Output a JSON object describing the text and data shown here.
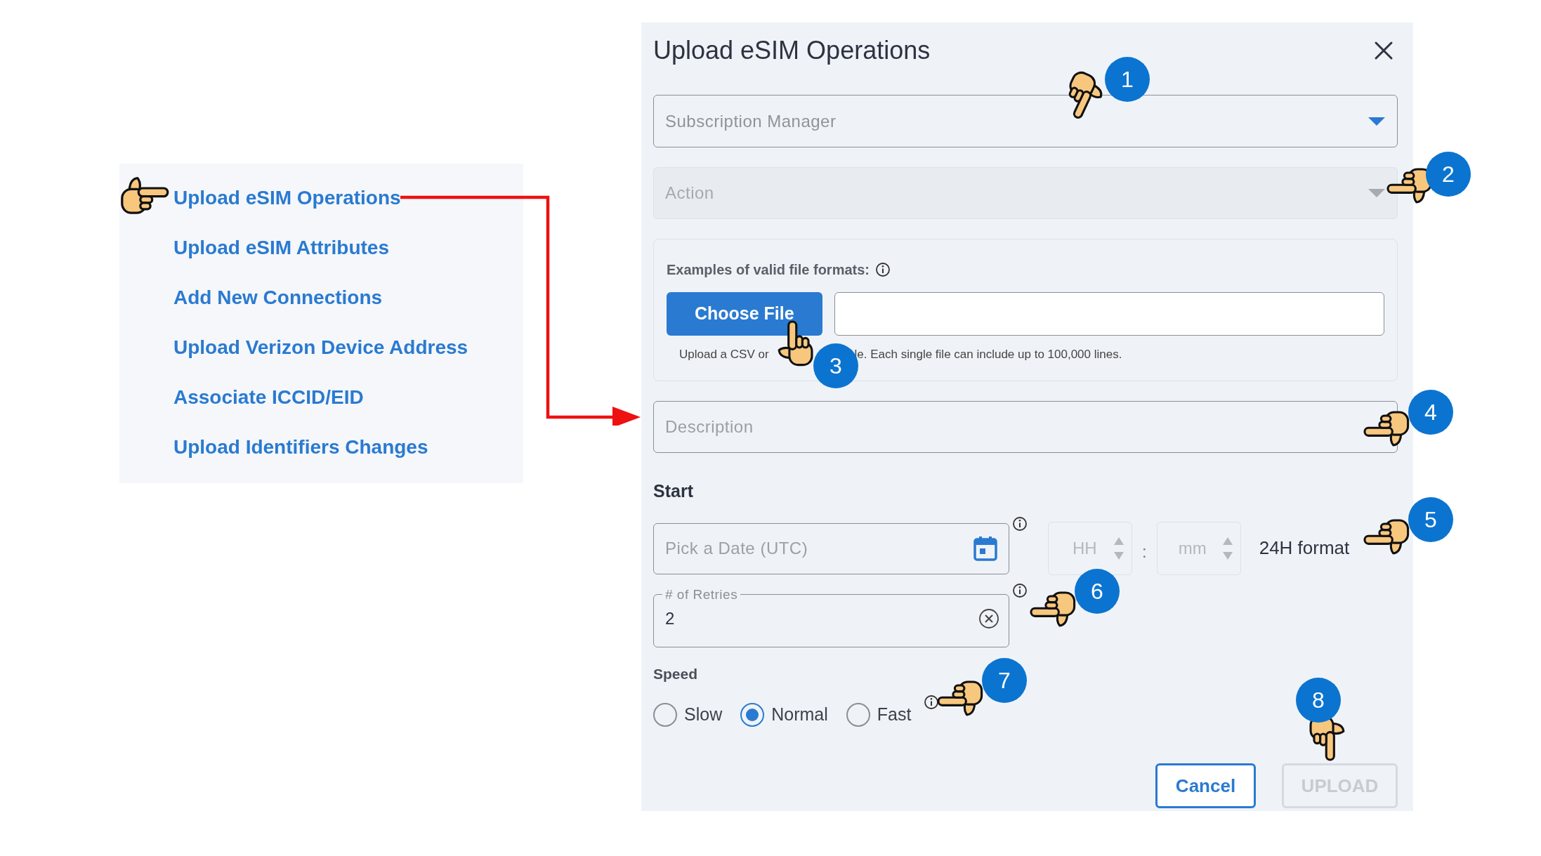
{
  "menu": {
    "items": [
      {
        "label": "Upload eSIM Operations"
      },
      {
        "label": "Upload eSIM Attributes"
      },
      {
        "label": "Add New Connections"
      },
      {
        "label": "Upload Verizon Device Address"
      },
      {
        "label": "Associate ICCID/EID"
      },
      {
        "label": "Upload Identifiers Changes"
      }
    ]
  },
  "dialog": {
    "title": "Upload eSIM Operations",
    "subscription_manager": {
      "placeholder": "Subscription Manager",
      "disabled": false
    },
    "action": {
      "placeholder": "Action",
      "disabled": true
    },
    "file_upload": {
      "label": "Examples of valid file formats:",
      "button": "Choose File",
      "helper_text_start": "Upload a CSV or",
      "helper_text_end": "le. Each single file can include up to 100,000 lines."
    },
    "description": {
      "placeholder": "Description"
    },
    "start": {
      "label": "Start",
      "date_placeholder": "Pick a Date (UTC)",
      "hour_placeholder": "HH",
      "separator": ":",
      "minute_placeholder": "mm",
      "format_note": "24H format"
    },
    "retries": {
      "label": "# of Retries",
      "value": "2"
    },
    "speed": {
      "label": "Speed",
      "options": [
        {
          "label": "Slow",
          "selected": false
        },
        {
          "label": "Normal",
          "selected": true
        },
        {
          "label": "Fast",
          "selected": false
        }
      ]
    },
    "buttons": [
      {
        "label": "Cancel",
        "disabled": false
      },
      {
        "label": "UPLOAD",
        "disabled": true
      }
    ]
  },
  "annotations": [
    {
      "number": "1"
    },
    {
      "number": "2"
    },
    {
      "number": "3"
    },
    {
      "number": "4"
    },
    {
      "number": "5"
    },
    {
      "number": "6"
    },
    {
      "number": "7"
    },
    {
      "number": "8"
    }
  ]
}
